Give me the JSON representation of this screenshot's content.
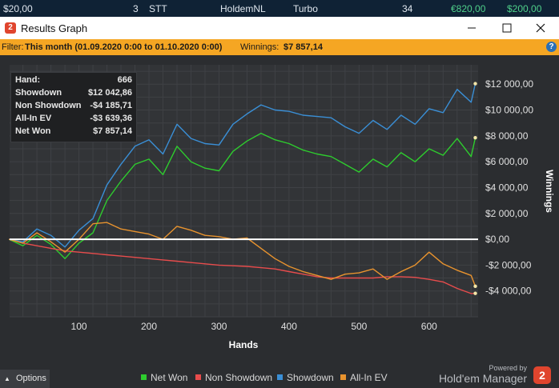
{
  "row": {
    "amount": "$20,00",
    "count": "3",
    "type": "STT",
    "game": "HoldemNL",
    "speed": "Turbo",
    "players": "34",
    "prize": "€820,00",
    "won": "$200,00"
  },
  "window": {
    "title": "Results Graph",
    "app_icon": "2"
  },
  "filter": {
    "label": "Filter:",
    "value": "This month (01.09.2020 0:00 to 01.10.2020 0:00)",
    "winnings_label": "Winnings:",
    "winnings_value": "$7 857,14",
    "help": "?"
  },
  "stats": {
    "hand_label": "Hand:",
    "hand_value": "666",
    "showdown_label": "Showdown",
    "showdown_value": "$12 042,86",
    "nonshowdown_label": "Non Showdown",
    "nonshowdown_value": "-$4 185,71",
    "allin_label": "All-In EV",
    "allin_value": "-$3 639,36",
    "net_label": "Net Won",
    "net_value": "$7 857,14"
  },
  "options_label": "Options",
  "brand": {
    "powered": "Powered by",
    "name": "Hold'em Manager",
    "logo": "2"
  },
  "colors": {
    "net_won": "#2ecc2e",
    "non_showdown": "#e84c4c",
    "showdown": "#3a8fd6",
    "allin_ev": "#e8932e"
  },
  "chart_data": {
    "type": "line",
    "xlabel": "Hands",
    "ylabel": "Winnings",
    "xlim": [
      1,
      670
    ],
    "ylim": [
      -6000,
      13500
    ],
    "xticks": [
      100,
      200,
      300,
      400,
      500,
      600
    ],
    "yticks": [
      -4000,
      -2000,
      0,
      2000,
      4000,
      6000,
      8000,
      10000,
      12000
    ],
    "ytick_labels": [
      "-$4 000,00",
      "-$2 000,00",
      "$0,00",
      "$2 000,00",
      "$4 000,00",
      "$6 000,00",
      "$8 000,00",
      "$10 000,00",
      "$12 000,00"
    ],
    "grid": true,
    "legend_position": "bottom",
    "x": [
      0,
      20,
      40,
      60,
      80,
      100,
      120,
      140,
      160,
      180,
      200,
      220,
      240,
      260,
      280,
      300,
      320,
      340,
      360,
      380,
      400,
      420,
      440,
      460,
      480,
      500,
      520,
      540,
      560,
      580,
      600,
      620,
      640,
      660,
      666
    ],
    "series": [
      {
        "name": "Net Won",
        "color": "#2ecc2e",
        "values": [
          0,
          -500,
          300,
          -400,
          -1500,
          -300,
          500,
          3000,
          4500,
          5800,
          6200,
          5000,
          7200,
          6000,
          5500,
          5300,
          6800,
          7600,
          8200,
          7700,
          7400,
          6900,
          6600,
          6400,
          5800,
          5200,
          6200,
          5600,
          6700,
          6000,
          7000,
          6500,
          7800,
          6400,
          7857
        ]
      },
      {
        "name": "Non Showdown",
        "color": "#e84c4c",
        "values": [
          0,
          -300,
          -500,
          -700,
          -900,
          -1000,
          -1100,
          -1200,
          -1300,
          -1400,
          -1500,
          -1600,
          -1700,
          -1800,
          -1900,
          -2000,
          -2050,
          -2100,
          -2200,
          -2300,
          -2500,
          -2700,
          -2900,
          -3000,
          -3000,
          -3000,
          -3000,
          -2900,
          -2900,
          -2950,
          -3100,
          -3300,
          -3800,
          -4200,
          -4186
        ]
      },
      {
        "name": "Showdown",
        "color": "#3a8fd6",
        "values": [
          0,
          -200,
          800,
          300,
          -600,
          700,
          1600,
          4200,
          5800,
          7200,
          7700,
          6600,
          8900,
          7800,
          7400,
          7300,
          8900,
          9700,
          10400,
          10000,
          9900,
          9600,
          9500,
          9400,
          8700,
          8200,
          9200,
          8500,
          9600,
          8900,
          10100,
          9800,
          11600,
          10600,
          12043
        ]
      },
      {
        "name": "All-In EV",
        "color": "#e8932e",
        "values": [
          0,
          -300,
          500,
          -200,
          -1000,
          0,
          1200,
          1300,
          800,
          600,
          400,
          0,
          1000,
          700,
          300,
          200,
          0,
          100,
          -700,
          -1500,
          -2100,
          -2500,
          -2800,
          -3100,
          -2700,
          -2600,
          -2300,
          -3100,
          -2500,
          -2000,
          -1000,
          -1900,
          -2400,
          -2800,
          -3639
        ]
      }
    ]
  }
}
